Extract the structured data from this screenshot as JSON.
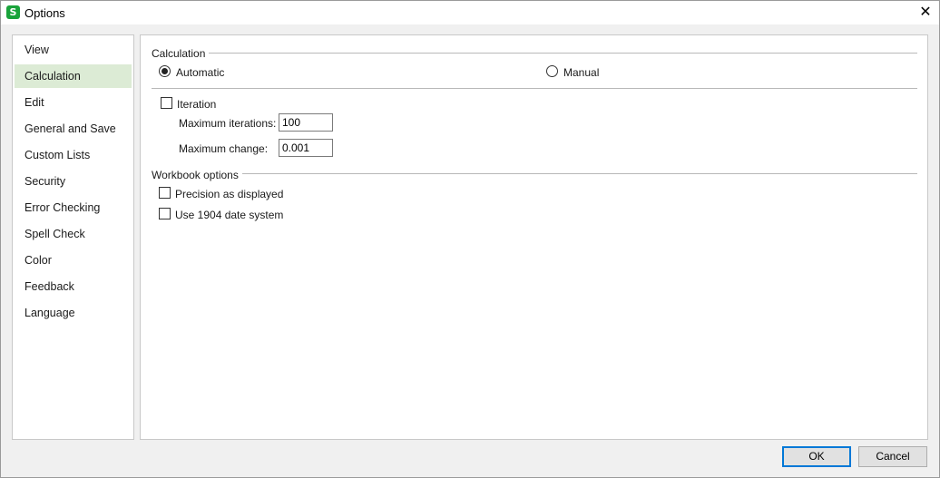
{
  "window": {
    "title": "Options",
    "app_icon": "wps-spreadsheet-icon",
    "close_glyph": "✕"
  },
  "sidebar": {
    "items": [
      {
        "label": "View",
        "active": false
      },
      {
        "label": "Calculation",
        "active": true
      },
      {
        "label": "Edit",
        "active": false
      },
      {
        "label": "General and Save",
        "active": false
      },
      {
        "label": "Custom Lists",
        "active": false
      },
      {
        "label": "Security",
        "active": false
      },
      {
        "label": "Error Checking",
        "active": false
      },
      {
        "label": "Spell Check",
        "active": false
      },
      {
        "label": "Color",
        "active": false
      },
      {
        "label": "Feedback",
        "active": false
      },
      {
        "label": "Language",
        "active": false
      }
    ]
  },
  "calculation": {
    "section_label": "Calculation",
    "automatic_label": "Automatic",
    "automatic_selected": true,
    "manual_label": "Manual",
    "manual_selected": false,
    "iteration_label": "Iteration",
    "iteration_checked": false,
    "max_iterations_label": "Maximum iterations:",
    "max_iterations_value": "100",
    "max_change_label": "Maximum change:",
    "max_change_value": "0.001"
  },
  "workbook": {
    "section_label": "Workbook options",
    "precision_label": "Precision as displayed",
    "precision_checked": false,
    "date1904_label": "Use 1904 date system",
    "date1904_checked": false
  },
  "footer": {
    "ok_label": "OK",
    "cancel_label": "Cancel"
  }
}
